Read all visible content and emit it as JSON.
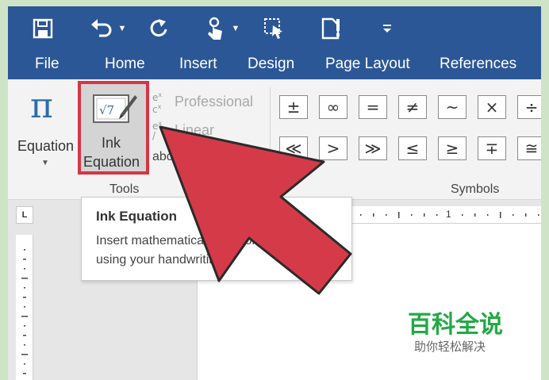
{
  "quick_access": {
    "icons": [
      "save-icon",
      "undo-icon",
      "redo-icon",
      "touch-mode-icon",
      "select-icon",
      "smart-lookup-icon",
      "customize-caret-icon"
    ]
  },
  "tabs": [
    {
      "label": "File"
    },
    {
      "label": "Home"
    },
    {
      "label": "Insert"
    },
    {
      "label": "Design"
    },
    {
      "label": "Page Layout"
    },
    {
      "label": "References"
    }
  ],
  "tools": {
    "equation_label": "Equation",
    "ink_line1": "Ink",
    "ink_line2": "Equation",
    "professional_label": "Professional",
    "linear_label": "Linear",
    "normal_text_partial": "abc",
    "group_label": "Tools"
  },
  "symbols": {
    "row1": [
      "±",
      "∞",
      "=",
      "≠",
      "~",
      "×",
      "÷"
    ],
    "row2": [
      "≪",
      ">",
      "≫",
      "≤",
      "≥",
      "∓",
      "≅"
    ],
    "group_label": "Symbols"
  },
  "ruler": {
    "corner_label": "L",
    "mark": "1"
  },
  "tooltip": {
    "title": "Ink Equation",
    "line1": "Insert mathematical equations",
    "line2": "using your handwriting."
  },
  "watermark": {
    "title": "百科全说",
    "subtitle": "助你轻松解决"
  },
  "colors": {
    "brand": "#2b5797",
    "highlight": "#d63545",
    "arrow": "#d53a48",
    "watermark": "#23a946"
  }
}
